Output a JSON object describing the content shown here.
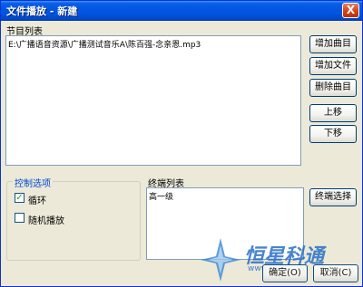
{
  "window": {
    "title": "文件播放 - 新建",
    "close_label": "X"
  },
  "program_list": {
    "label": "节目列表",
    "items": [
      "E:\\广播语音资源\\广播测试音乐A\\陈百强-念亲恩.mp3"
    ]
  },
  "right_buttons": {
    "add_track": "增加曲目",
    "add_file": "增加文件",
    "delete_track": "删除曲目",
    "move_up": "上移",
    "move_down": "下移"
  },
  "control_options": {
    "title": "控制选项",
    "loop": {
      "label": "循环",
      "checked": true
    },
    "shuffle": {
      "label": "随机播放",
      "checked": false
    }
  },
  "terminal_list": {
    "label": "终端列表",
    "items": [
      "高一级"
    ]
  },
  "terminal_select_button": "终端选择",
  "bottom_buttons": {
    "ok": "确定(O)",
    "cancel": "取消(C)"
  },
  "watermark": {
    "brand": "恒星科通",
    "url": "www.hxkt.com"
  }
}
